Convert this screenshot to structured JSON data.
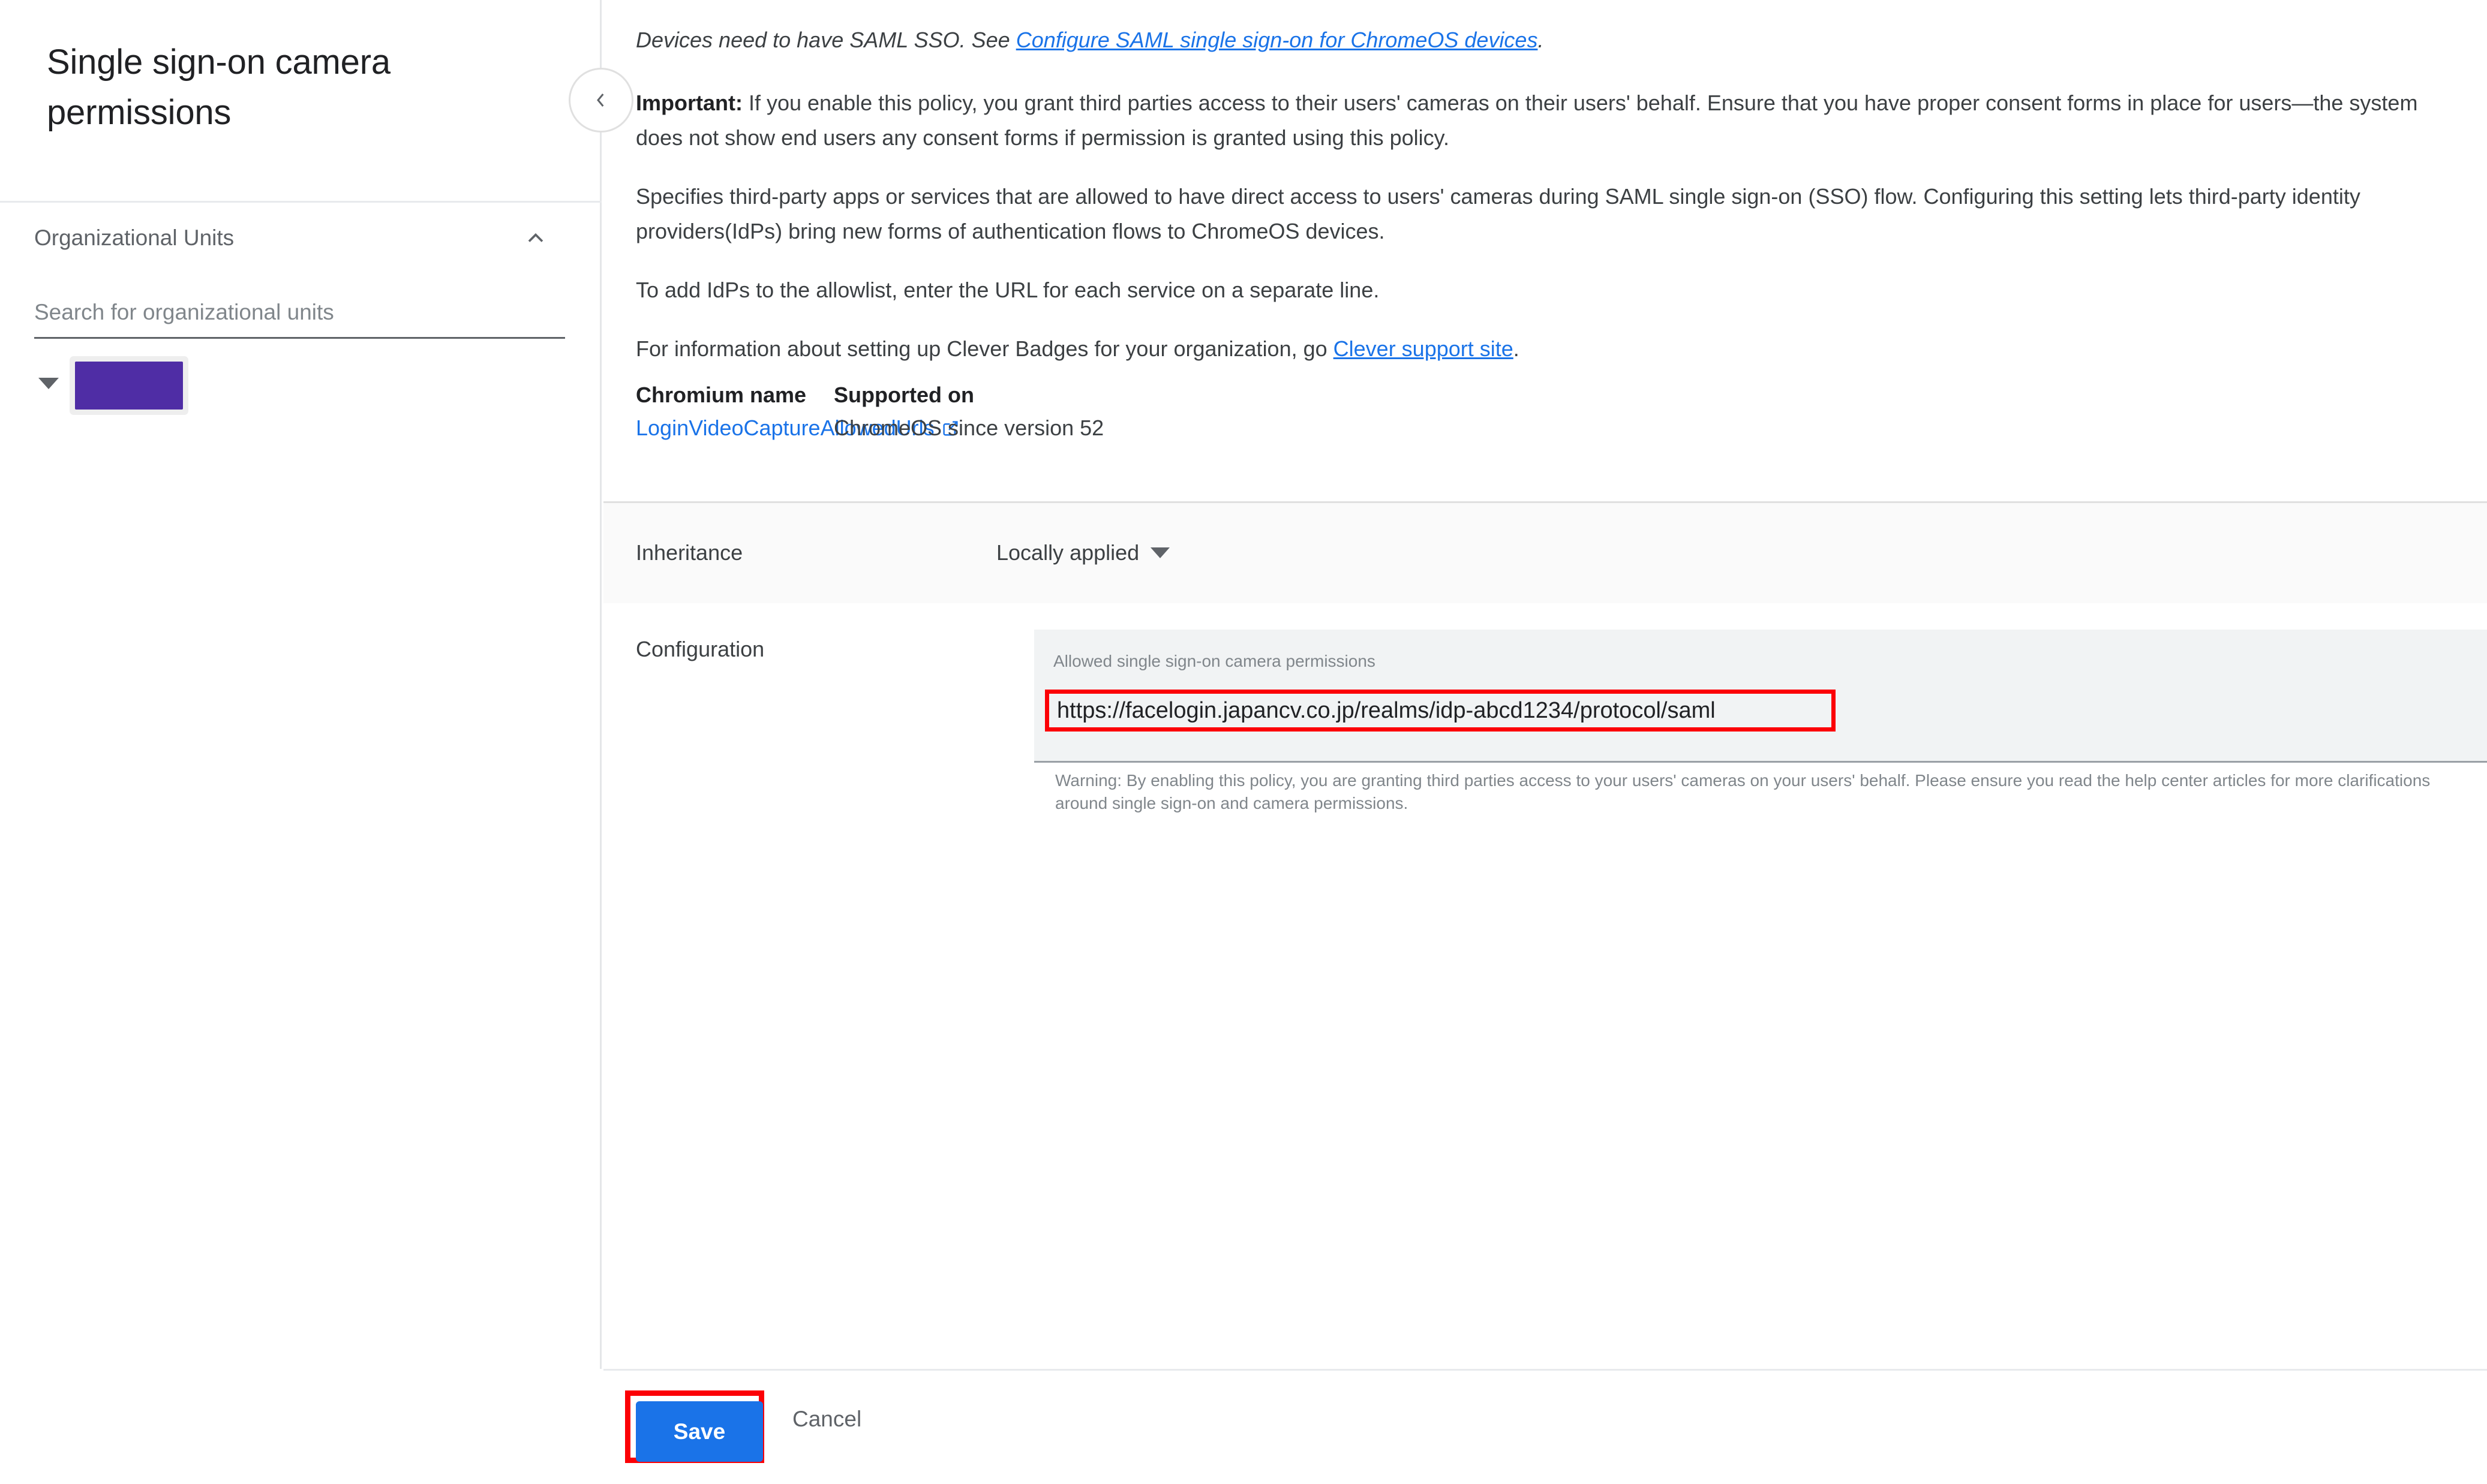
{
  "sidebar": {
    "title": "Single sign-on camera permissions",
    "org_units": {
      "section_label": "Organizational Units",
      "collapse_icon": "chevron-up-icon",
      "search_placeholder": "Search for organizational units",
      "search_value": "",
      "nodes": [
        {
          "expand_icon": "caret-down-icon",
          "name": "",
          "redacted": true,
          "color": "#4f2da5"
        }
      ]
    },
    "collapse_panel_icon": "chevron-left-icon"
  },
  "main": {
    "description": {
      "note_prefix": "Devices need to have SAML SSO. See ",
      "note_link": "Configure SAML single sign-on for ChromeOS devices",
      "note_suffix": ".",
      "important_label": "Important:",
      "important_text": " If you enable this policy, you grant third parties access to their users' cameras on their users' behalf. Ensure that you have proper consent forms in place for users—the system does not show end users any consent forms if permission is granted using this policy.",
      "paragraph_2": "Specifies third-party apps or services that are allowed to have direct access to users' cameras during SAML single sign-on (SSO) flow. Configuring this setting lets third-party identity providers(IdPs) bring new forms of authentication flows to ChromeOS devices.",
      "paragraph_3": "To add IdPs to the allowlist, enter the URL for each service on a separate line.",
      "paragraph_4_prefix": "For information about setting up Clever Badges for your organization, go ",
      "paragraph_4_link": "Clever support site",
      "paragraph_4_suffix": "."
    },
    "meta": {
      "chromium_name_label": "Chromium name",
      "chromium_name_value": "LoginVideoCaptureAllowedUrls",
      "chromium_name_icon": "external-link-icon",
      "supported_on_label": "Supported on",
      "supported_on_value": "ChromeOS since version 52"
    },
    "inheritance": {
      "label": "Inheritance",
      "value": "Locally applied",
      "caret_icon": "caret-down-icon"
    },
    "configuration": {
      "label": "Configuration",
      "field_label": "Allowed single sign-on camera permissions",
      "field_value": "https://facelogin.japancv.co.jp/realms/idp-abcd1234/protocol/saml",
      "field_placeholder": "",
      "warning": "Warning: By enabling this policy, you are granting third parties access to your users' cameras on your users' behalf. Please ensure you read the help center articles for more clarifications around single sign-on and camera permissions.",
      "highlight_color": "#fc0006"
    }
  },
  "footer": {
    "save_label": "Save",
    "cancel_label": "Cancel",
    "save_color": "#1a73e8",
    "highlight_color": "#fc0006"
  }
}
